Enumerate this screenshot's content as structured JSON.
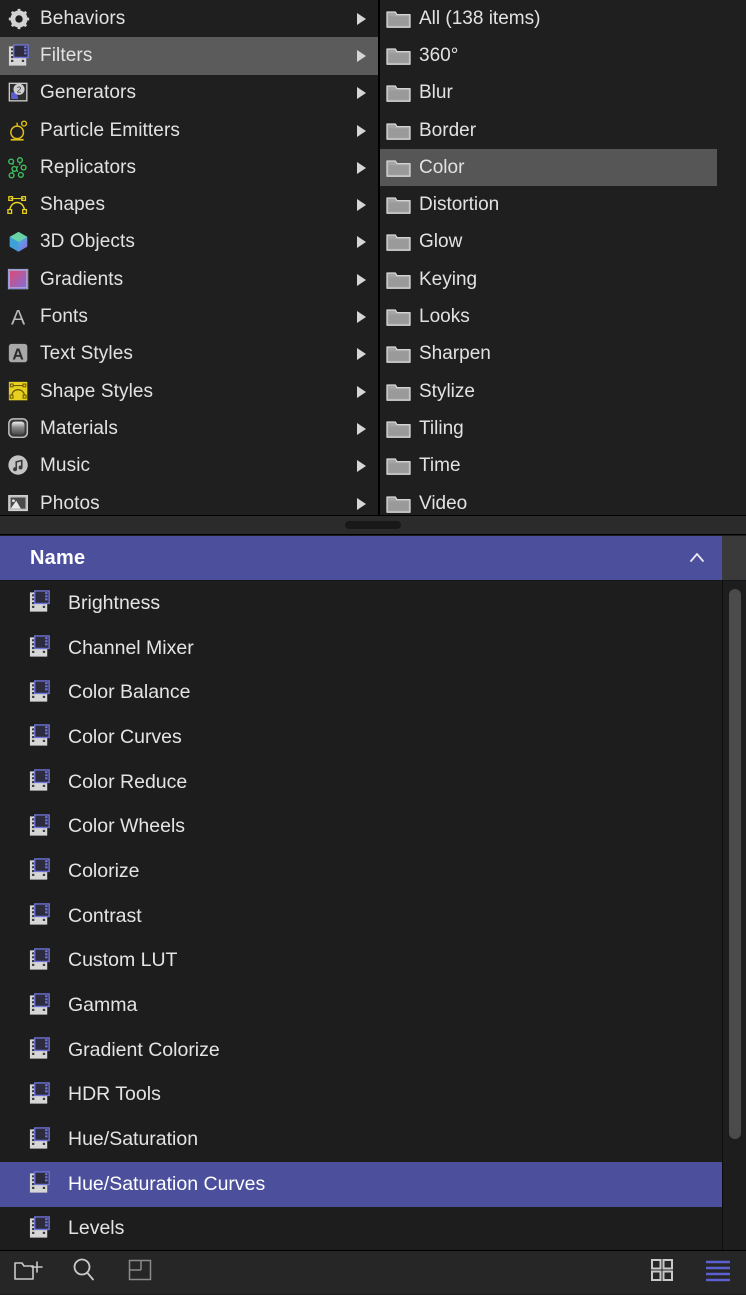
{
  "categories_panel": {
    "items": [
      {
        "label": "Behaviors",
        "icon": "gear-icon",
        "selected": false,
        "has_submenu": true
      },
      {
        "label": "Filters",
        "icon": "filmstrip-filter-icon",
        "selected": true,
        "has_submenu": true
      },
      {
        "label": "Generators",
        "icon": "generator-icon",
        "selected": false,
        "has_submenu": true
      },
      {
        "label": "Particle Emitters",
        "icon": "particle-emitter-icon",
        "selected": false,
        "has_submenu": true
      },
      {
        "label": "Replicators",
        "icon": "replicator-icon",
        "selected": false,
        "has_submenu": true
      },
      {
        "label": "Shapes",
        "icon": "shape-bezier-icon",
        "selected": false,
        "has_submenu": true
      },
      {
        "label": "3D Objects",
        "icon": "cube-3d-icon",
        "selected": false,
        "has_submenu": true
      },
      {
        "label": "Gradients",
        "icon": "gradient-swatch-icon",
        "selected": false,
        "has_submenu": true
      },
      {
        "label": "Fonts",
        "icon": "letter-a-icon",
        "selected": false,
        "has_submenu": true
      },
      {
        "label": "Text Styles",
        "icon": "text-style-icon",
        "selected": false,
        "has_submenu": true
      },
      {
        "label": "Shape Styles",
        "icon": "shape-style-icon",
        "selected": false,
        "has_submenu": true
      },
      {
        "label": "Materials",
        "icon": "material-sphere-icon",
        "selected": false,
        "has_submenu": true
      },
      {
        "label": "Music",
        "icon": "music-note-icon",
        "selected": false,
        "has_submenu": true
      },
      {
        "label": "Photos",
        "icon": "photo-icon",
        "selected": false,
        "has_submenu": true
      }
    ]
  },
  "folders_panel": {
    "items": [
      {
        "label": "All (138 items)",
        "icon": "folder-icon",
        "selected": false
      },
      {
        "label": "360°",
        "icon": "folder-icon",
        "selected": false
      },
      {
        "label": "Blur",
        "icon": "folder-icon",
        "selected": false
      },
      {
        "label": "Border",
        "icon": "folder-icon",
        "selected": false
      },
      {
        "label": "Color",
        "icon": "folder-icon",
        "selected": true
      },
      {
        "label": "Distortion",
        "icon": "folder-icon",
        "selected": false
      },
      {
        "label": "Glow",
        "icon": "folder-icon",
        "selected": false
      },
      {
        "label": "Keying",
        "icon": "folder-icon",
        "selected": false
      },
      {
        "label": "Looks",
        "icon": "folder-icon",
        "selected": false
      },
      {
        "label": "Sharpen",
        "icon": "folder-icon",
        "selected": false
      },
      {
        "label": "Stylize",
        "icon": "folder-icon",
        "selected": false
      },
      {
        "label": "Tiling",
        "icon": "folder-icon",
        "selected": false
      },
      {
        "label": "Time",
        "icon": "folder-icon",
        "selected": false
      },
      {
        "label": "Video",
        "icon": "folder-icon",
        "selected": false
      }
    ]
  },
  "list_header": {
    "column_label": "Name",
    "sort_indicator": "chevron-up-icon",
    "accent_color": "#4c4f9b"
  },
  "filter_list": {
    "items": [
      {
        "label": "Brightness",
        "icon": "filmstrip-filter-icon",
        "selected": false
      },
      {
        "label": "Channel Mixer",
        "icon": "filmstrip-filter-icon",
        "selected": false
      },
      {
        "label": "Color Balance",
        "icon": "filmstrip-filter-icon",
        "selected": false
      },
      {
        "label": "Color Curves",
        "icon": "filmstrip-filter-icon",
        "selected": false
      },
      {
        "label": "Color Reduce",
        "icon": "filmstrip-filter-icon",
        "selected": false
      },
      {
        "label": "Color Wheels",
        "icon": "filmstrip-filter-icon",
        "selected": false
      },
      {
        "label": "Colorize",
        "icon": "filmstrip-filter-icon",
        "selected": false
      },
      {
        "label": "Contrast",
        "icon": "filmstrip-filter-icon",
        "selected": false
      },
      {
        "label": "Custom LUT",
        "icon": "filmstrip-filter-icon",
        "selected": false
      },
      {
        "label": "Gamma",
        "icon": "filmstrip-filter-icon",
        "selected": false
      },
      {
        "label": "Gradient Colorize",
        "icon": "filmstrip-filter-icon",
        "selected": false
      },
      {
        "label": "HDR Tools",
        "icon": "filmstrip-filter-icon",
        "selected": false
      },
      {
        "label": "Hue/Saturation",
        "icon": "filmstrip-filter-icon",
        "selected": false
      },
      {
        "label": "Hue/Saturation Curves",
        "icon": "filmstrip-filter-icon",
        "selected": true
      },
      {
        "label": "Levels",
        "icon": "filmstrip-filter-icon",
        "selected": false
      }
    ]
  },
  "bottom_toolbar": {
    "left_buttons": [
      {
        "name": "new-folder-button",
        "icon": "new-folder-icon"
      },
      {
        "name": "search-button",
        "icon": "search-icon"
      },
      {
        "name": "panel-toggle-button",
        "icon": "panel-layout-icon"
      }
    ],
    "right_buttons": [
      {
        "name": "grid-view-button",
        "icon": "grid-view-icon",
        "active": false
      },
      {
        "name": "list-view-button",
        "icon": "list-view-icon",
        "active": true
      }
    ],
    "active_color": "#5b5fd0"
  }
}
